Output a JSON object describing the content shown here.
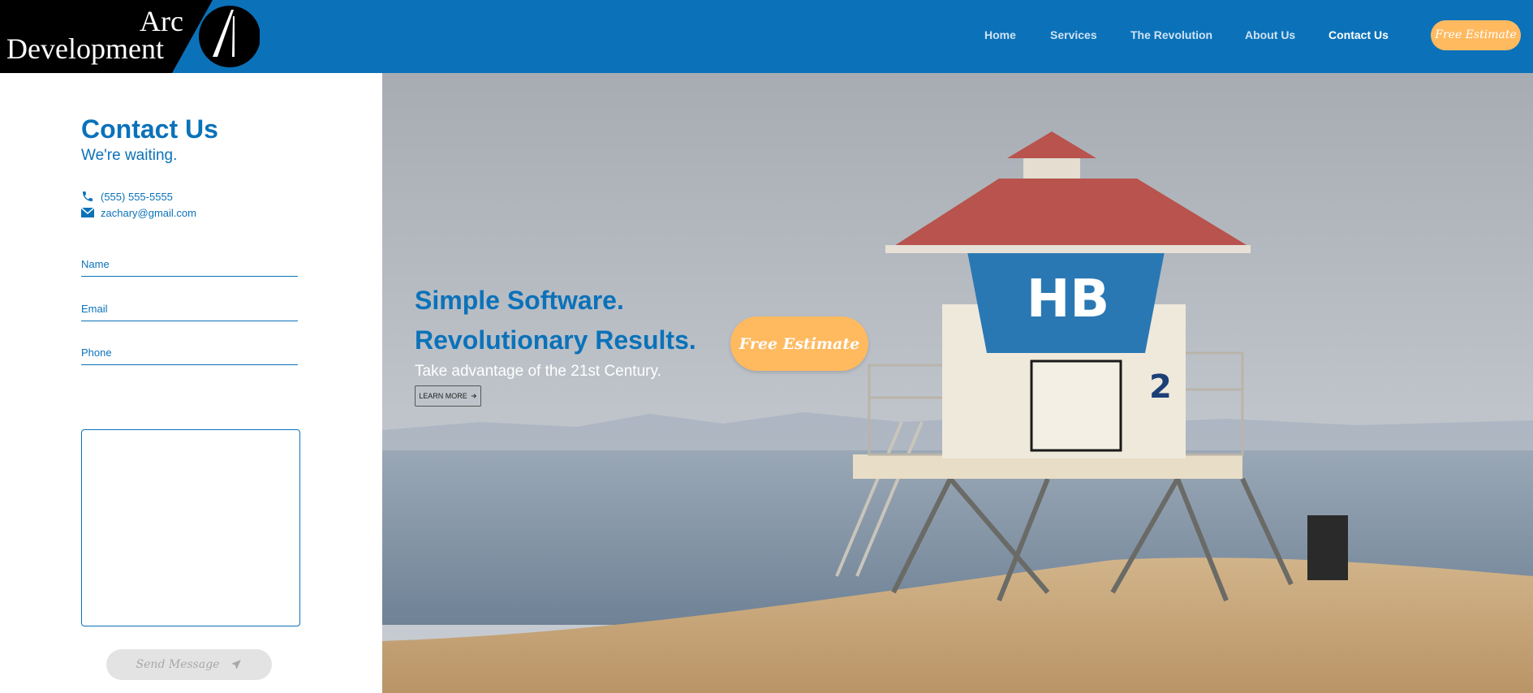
{
  "brand": {
    "line1": "Arc",
    "line2": "Development",
    "mark_icon": "arc-logo-icon"
  },
  "nav": {
    "items": [
      {
        "label": "Home",
        "active": false
      },
      {
        "label": "Services",
        "active": false
      },
      {
        "label": "The Revolution",
        "active": false
      },
      {
        "label": "About Us",
        "active": false
      },
      {
        "label": "Contact Us",
        "active": true
      }
    ],
    "cta_label": "Free Estimate"
  },
  "contact": {
    "title": "Contact Us",
    "subtitle": "We're waiting.",
    "phone": "(555) 555-5555",
    "phone_icon": "phone-icon",
    "email": "zachary@gmail.com",
    "email_icon": "envelope-icon",
    "form": {
      "name_placeholder": "Name",
      "email_placeholder": "Email",
      "phone_placeholder": "Phone",
      "message_value": "",
      "send_label": "Send Message",
      "send_icon": "paper-plane-icon"
    }
  },
  "hero": {
    "heading_line1": "Simple Software.",
    "heading_line2": "Revolutionary Results.",
    "subheading": "Take advantage of the 21st Century.",
    "learn_more_label": "LEARN MORE",
    "learn_more_icon": "arrow-right-icon",
    "cta_label": "Free Estimate",
    "background": "beach-lifeguard-tower-photo"
  },
  "colors": {
    "primary": "#0b72b9",
    "accent": "#ffba60",
    "logo_bg": "#000000",
    "disabled": "#e3e3e3"
  }
}
